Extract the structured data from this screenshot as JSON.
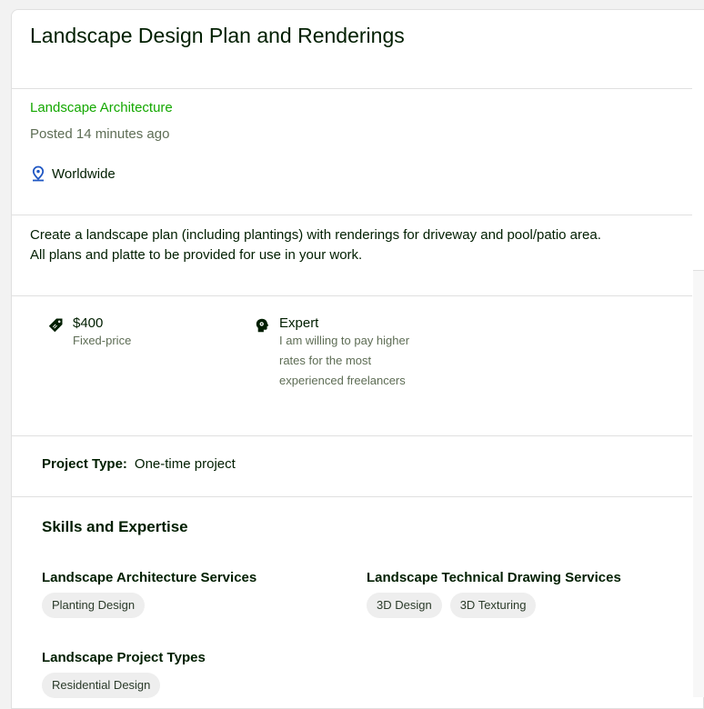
{
  "job": {
    "title": "Landscape Design Plan and Renderings",
    "category": "Landscape Architecture",
    "posted": "Posted 14 minutes ago",
    "location": "Worldwide",
    "description_line1": "Create a landscape plan (including plantings) with renderings for driveway and pool/patio area.",
    "description_line2": "All plans and platte to be provided for use in your work."
  },
  "features": {
    "price": {
      "value": "$400",
      "label": "Fixed-price",
      "icon": "tag-icon"
    },
    "level": {
      "value": "Expert",
      "label_1": "I am willing to pay higher",
      "label_2": "rates for the most",
      "label_3": "experienced freelancers",
      "icon": "expert-head-icon"
    }
  },
  "project_type": {
    "label": "Project Type:",
    "value": "One-time project"
  },
  "skills": {
    "heading": "Skills and Expertise",
    "groups": [
      {
        "title": "Landscape Architecture Services",
        "chips": [
          "Planting Design"
        ]
      },
      {
        "title": "Landscape Technical Drawing Services",
        "chips": [
          "3D Design",
          "3D Texturing"
        ]
      },
      {
        "title": "Landscape Project Types",
        "chips": [
          "Residential Design"
        ]
      }
    ]
  },
  "colors": {
    "accent": "#14a800",
    "text": "#001e00",
    "muted": "#5e6d55",
    "chip_bg": "#eeeeee",
    "pin": "#1f57c3"
  }
}
